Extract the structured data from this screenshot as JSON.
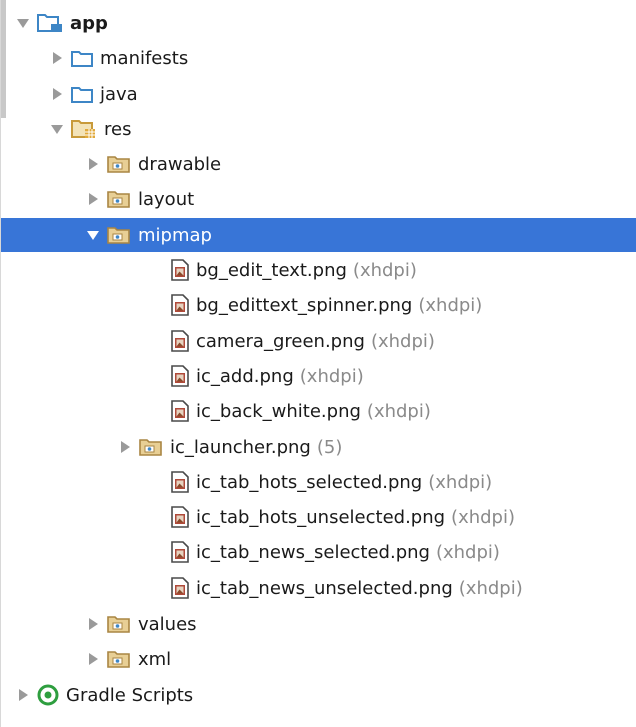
{
  "tree": {
    "rows": [
      {
        "label": "app",
        "hint": "",
        "bold": true,
        "arrow": "expanded",
        "icon": "module-folder-icon",
        "selected": false
      },
      {
        "label": "manifests",
        "hint": "",
        "bold": false,
        "arrow": "collapsed",
        "icon": "folder-icon",
        "selected": false
      },
      {
        "label": "java",
        "hint": "",
        "bold": false,
        "arrow": "collapsed",
        "icon": "folder-icon",
        "selected": false
      },
      {
        "label": "res",
        "hint": "",
        "bold": false,
        "arrow": "expanded",
        "icon": "resources-folder-icon",
        "selected": false
      },
      {
        "label": "drawable",
        "hint": "",
        "bold": false,
        "arrow": "collapsed",
        "icon": "resource-folder-icon",
        "selected": false
      },
      {
        "label": "layout",
        "hint": "",
        "bold": false,
        "arrow": "collapsed",
        "icon": "resource-folder-icon",
        "selected": false
      },
      {
        "label": "mipmap",
        "hint": "",
        "bold": false,
        "arrow": "expanded",
        "icon": "resource-folder-icon",
        "selected": true
      },
      {
        "label": "bg_edit_text.png",
        "hint": "(xhdpi)",
        "bold": false,
        "arrow": "none",
        "icon": "image-file-icon",
        "selected": false
      },
      {
        "label": "bg_edittext_spinner.png",
        "hint": "(xhdpi)",
        "bold": false,
        "arrow": "none",
        "icon": "image-file-icon",
        "selected": false
      },
      {
        "label": "camera_green.png",
        "hint": "(xhdpi)",
        "bold": false,
        "arrow": "none",
        "icon": "image-file-icon",
        "selected": false
      },
      {
        "label": "ic_add.png",
        "hint": "(xhdpi)",
        "bold": false,
        "arrow": "none",
        "icon": "image-file-icon",
        "selected": false
      },
      {
        "label": "ic_back_white.png",
        "hint": "(xhdpi)",
        "bold": false,
        "arrow": "none",
        "icon": "image-file-icon",
        "selected": false
      },
      {
        "label": "ic_launcher.png",
        "hint": "(5)",
        "bold": false,
        "arrow": "collapsed",
        "icon": "resource-folder-icon",
        "selected": false
      },
      {
        "label": "ic_tab_hots_selected.png",
        "hint": "(xhdpi)",
        "bold": false,
        "arrow": "none",
        "icon": "image-file-icon",
        "selected": false
      },
      {
        "label": "ic_tab_hots_unselected.png",
        "hint": "(xhdpi)",
        "bold": false,
        "arrow": "none",
        "icon": "image-file-icon",
        "selected": false
      },
      {
        "label": "ic_tab_news_selected.png",
        "hint": "(xhdpi)",
        "bold": false,
        "arrow": "none",
        "icon": "image-file-icon",
        "selected": false
      },
      {
        "label": "ic_tab_news_unselected.png",
        "hint": "(xhdpi)",
        "bold": false,
        "arrow": "none",
        "icon": "image-file-icon",
        "selected": false
      },
      {
        "label": "values",
        "hint": "",
        "bold": false,
        "arrow": "collapsed",
        "icon": "resource-folder-icon",
        "selected": false
      },
      {
        "label": "xml",
        "hint": "",
        "bold": false,
        "arrow": "collapsed",
        "icon": "resource-folder-icon",
        "selected": false
      },
      {
        "label": "Gradle Scripts",
        "hint": "",
        "bold": false,
        "arrow": "collapsed",
        "icon": "gradle-icon",
        "selected": false
      }
    ]
  },
  "colors": {
    "selection": "#3875d7",
    "folder_blue": "#3d86c6",
    "folder_tan": "#d9b56a",
    "gradle_green": "#2e9e3f",
    "hint_gray": "#8a8a8a"
  }
}
